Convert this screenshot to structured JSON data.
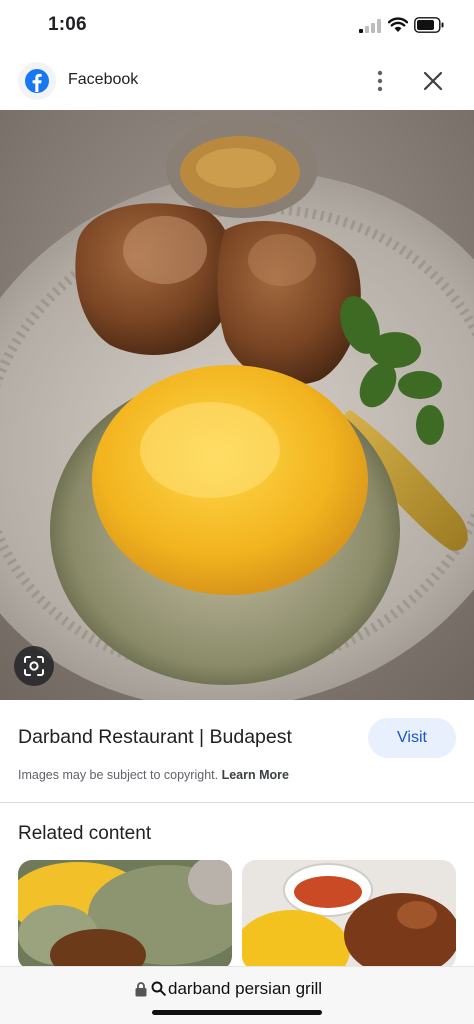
{
  "status_bar": {
    "time": "1:06"
  },
  "header": {
    "source_name": "Facebook"
  },
  "result": {
    "title": "Darband Restaurant | Budapest",
    "visit_label": "Visit",
    "copyright_text": "Images may be subject to copyright.",
    "learn_more": "Learn More"
  },
  "related": {
    "heading": "Related content"
  },
  "url_bar": {
    "query": "darband persian grill"
  },
  "colors": {
    "accent": "#1a56c4",
    "visit_bg": "#e8f0fe",
    "facebook_blue": "#1877f2"
  }
}
